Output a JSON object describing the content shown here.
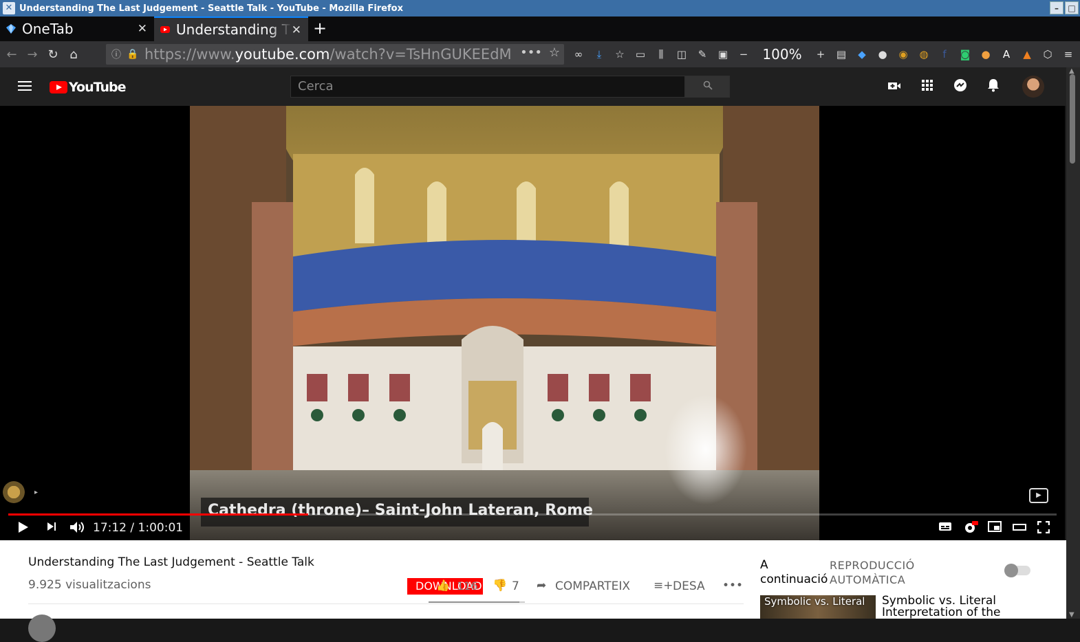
{
  "window": {
    "title": "Understanding The Last Judgement - Seattle Talk - YouTube - Mozilla Firefox",
    "minimize_label": "–",
    "maximize_label": "□"
  },
  "tabs": [
    {
      "label": "OneTab",
      "active": false
    },
    {
      "label": "Understanding The Last Judgement - Seattle Talk - YouTube",
      "active": true
    }
  ],
  "urlbar": {
    "url_prefix": "https://www.",
    "url_domain": "youtube.com",
    "url_path": "/watch?v=TsHnGUKEEdM"
  },
  "toolbar": {
    "zoom": "100%"
  },
  "youtube": {
    "logo_text": "YouTube",
    "search_placeholder": "Cerca"
  },
  "player": {
    "caption": "Cathedra (throne)– Saint-John Lateran, Rome",
    "current_time": "17:12",
    "duration": "1:00:01",
    "time_separator": "/",
    "progress_fraction": 0.286,
    "subscribe_watermark": "▶"
  },
  "video": {
    "title": "Understanding The Last Judgement - Seattle Talk",
    "views": "9.925 visualitzacions",
    "download_label": "DOWNLOAD",
    "likes": "116",
    "dislikes": "7",
    "share_label": "COMPARTEIX",
    "save_label": "DESA",
    "like_fraction": 0.94
  },
  "sidebar": {
    "up_next": "A continuació",
    "autoplay": "REPRODUCCIÓ AUTOMÀTICA",
    "rec_thumb_text": "Symbolic vs. Literal",
    "rec_title": "Symbolic vs. Literal Interpretation of the"
  },
  "colors": {
    "accent_blue": "#0a84ff",
    "youtube_red": "#ff0000",
    "titlebar": "#3a6ea5"
  }
}
